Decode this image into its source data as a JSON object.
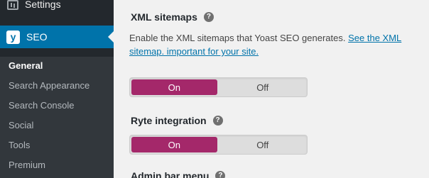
{
  "sidebar": {
    "settings_label": "Settings",
    "seo_label": "SEO",
    "submenu": [
      {
        "label": "General"
      },
      {
        "label": "Search Appearance"
      },
      {
        "label": "Search Console"
      },
      {
        "label": "Social"
      },
      {
        "label": "Tools"
      },
      {
        "label": "Premium"
      }
    ]
  },
  "main": {
    "xml_sitemaps": {
      "label": "XML sitemaps",
      "help": "?",
      "description_text": "Enable the XML sitemaps that Yoast SEO generates. ",
      "description_link": "See the XML sitemap. important for your site.",
      "toggle": {
        "on_label": "On",
        "off_label": "Off",
        "selected": "On"
      }
    },
    "ryte_integration": {
      "label": "Ryte integration",
      "help": "?",
      "toggle": {
        "on_label": "On",
        "off_label": "Off",
        "selected": "On"
      }
    },
    "admin_bar_menu": {
      "label": "Admin bar menu",
      "help": "?"
    }
  },
  "colors": {
    "sidebar_bg": "#23282d",
    "submenu_bg": "#32373c",
    "active_menu": "#0073aa",
    "toggle_on": "#a4286a",
    "link": "#0073aa"
  }
}
